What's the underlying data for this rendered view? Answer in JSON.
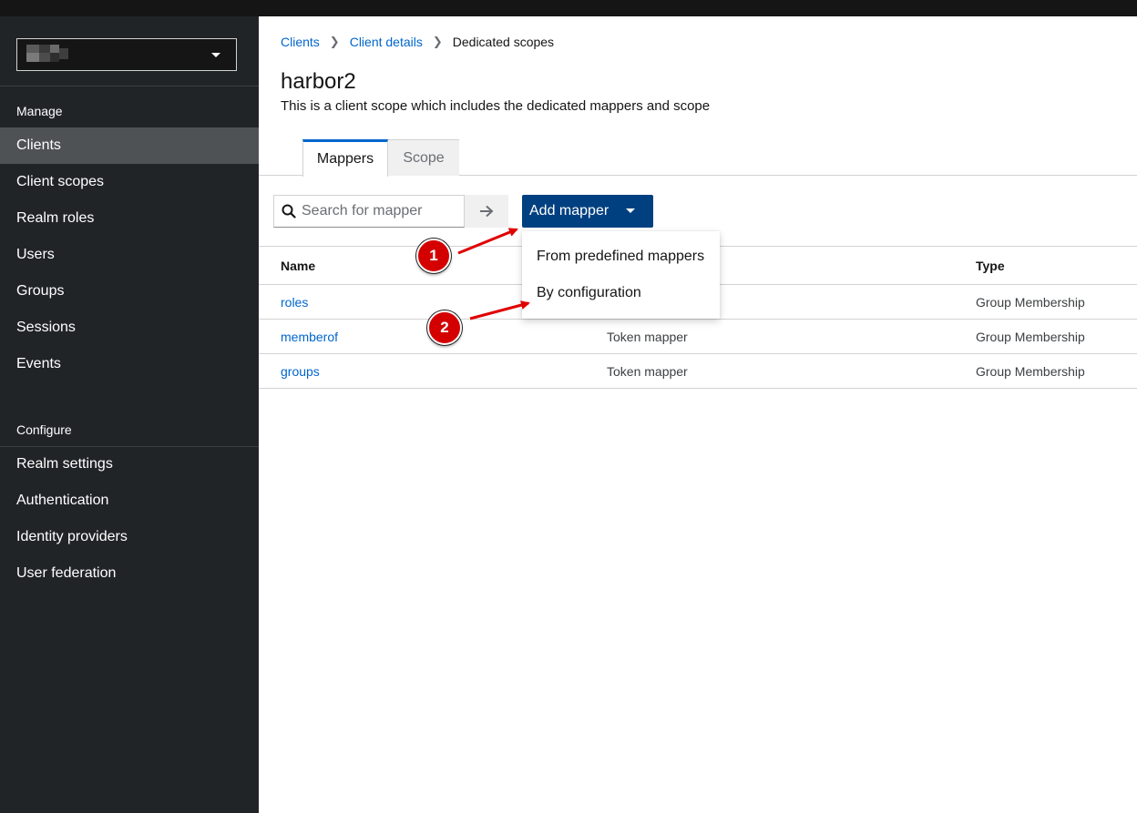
{
  "sidebar": {
    "sections": [
      {
        "title": "Manage",
        "items": [
          "Clients",
          "Client scopes",
          "Realm roles",
          "Users",
          "Groups",
          "Sessions",
          "Events"
        ]
      },
      {
        "title": "Configure",
        "items": [
          "Realm settings",
          "Authentication",
          "Identity providers",
          "User federation"
        ]
      }
    ],
    "active_item": "Clients"
  },
  "breadcrumb": {
    "items": [
      "Clients",
      "Client details"
    ],
    "current": "Dedicated scopes"
  },
  "page": {
    "title": "harbor2",
    "description": "This is a client scope which includes the dedicated mappers and scope"
  },
  "tabs": [
    {
      "label": "Mappers",
      "active": true
    },
    {
      "label": "Scope",
      "active": false
    }
  ],
  "toolbar": {
    "search_placeholder": "Search for mapper",
    "add_button_label": "Add mapper"
  },
  "dropdown": {
    "items": [
      "From predefined mappers",
      "By configuration"
    ]
  },
  "table": {
    "columns": [
      "Name",
      "",
      "Type"
    ],
    "rows": [
      {
        "name": "roles",
        "category": "",
        "type": "Group Membership"
      },
      {
        "name": "memberof",
        "category": "Token mapper",
        "type": "Group Membership"
      },
      {
        "name": "groups",
        "category": "Token mapper",
        "type": "Group Membership"
      }
    ]
  },
  "annotations": [
    {
      "number": "1"
    },
    {
      "number": "2"
    }
  ],
  "colors": {
    "sidebar_bg": "#212427",
    "active_nav_bg": "#4f5255",
    "primary_button": "#004080",
    "link": "#0066cc",
    "annotation_red": "#d40000"
  }
}
